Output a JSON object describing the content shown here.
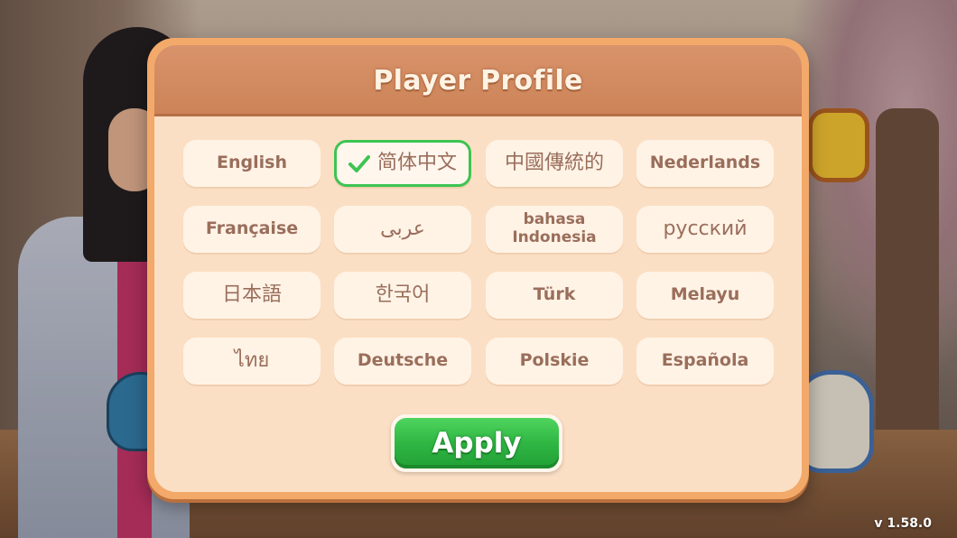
{
  "dialog": {
    "title": "Player Profile",
    "apply_label": "Apply"
  },
  "languages": [
    {
      "label": "English",
      "selected": false
    },
    {
      "label": "简体中文",
      "selected": true
    },
    {
      "label": "中國傳統的",
      "selected": false
    },
    {
      "label": "Nederlands",
      "selected": false
    },
    {
      "label": "Française",
      "selected": false
    },
    {
      "label": "عربى",
      "selected": false
    },
    {
      "label": "bahasa Indonesia",
      "selected": false
    },
    {
      "label": "русский",
      "selected": false
    },
    {
      "label": "日本語",
      "selected": false
    },
    {
      "label": "한국어",
      "selected": false
    },
    {
      "label": "Türk",
      "selected": false
    },
    {
      "label": "Melayu",
      "selected": false
    },
    {
      "label": "ไทย",
      "selected": false
    },
    {
      "label": "Deutsche",
      "selected": false
    },
    {
      "label": "Polskie",
      "selected": false
    },
    {
      "label": "Española",
      "selected": false
    }
  ],
  "version": "v 1.58.0",
  "colors": {
    "selected_border": "#3dc452",
    "apply_button": "#2fb643",
    "header": "#d9936a",
    "panel": "#fbdfc4",
    "label_text": "#9a6e5b"
  },
  "icons": {
    "selected_marker": "checkmark-icon"
  }
}
